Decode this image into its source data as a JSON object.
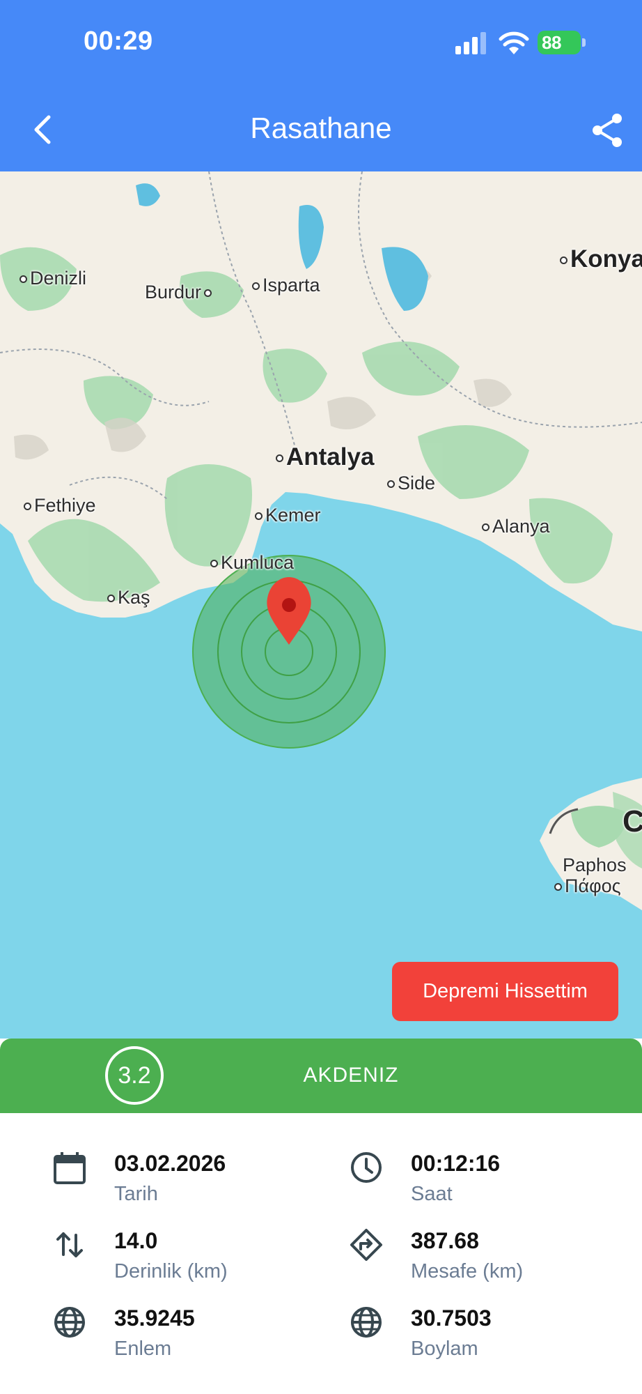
{
  "status_bar": {
    "time": "00:29",
    "battery": "88"
  },
  "header": {
    "title": "Rasathane"
  },
  "map": {
    "cities": {
      "denizli": "Denizli",
      "burdur": "Burdur",
      "isparta": "Isparta",
      "konya": "Konya",
      "antalya": "Antalya",
      "side": "Side",
      "fethiye": "Fethiye",
      "kemer": "Kemer",
      "alanya": "Alanya",
      "kumluca": "Kumluca",
      "kas": "Kaş",
      "paphos": "Paphos",
      "paphos_greek": "Πάφος",
      "cyprus_partial": "C"
    },
    "felt_button": "Depremi Hissettim"
  },
  "quake": {
    "magnitude": "3.2",
    "region": "AKDENIZ"
  },
  "details": {
    "date": {
      "value": "03.02.2026",
      "label": "Tarih"
    },
    "time": {
      "value": "00:12:16",
      "label": "Saat"
    },
    "depth": {
      "value": "14.0",
      "label": "Derinlik (km)"
    },
    "distance": {
      "value": "387.68",
      "label": "Mesafe (km)"
    },
    "latitude": {
      "value": "35.9245",
      "label": "Enlem"
    },
    "longitude": {
      "value": "30.7503",
      "label": "Boylam"
    }
  },
  "colors": {
    "header": "#4689F8",
    "sea": "#7FD5EA",
    "land": "#F3EFE6",
    "magnitude_bar": "#4CAF50",
    "felt_button": "#F2413A",
    "pin": "#EA4335"
  },
  "icons": [
    "back-icon",
    "share-icon",
    "calendar-icon",
    "clock-icon",
    "depth-icon",
    "direction-icon",
    "globe-icon",
    "pin-icon"
  ]
}
